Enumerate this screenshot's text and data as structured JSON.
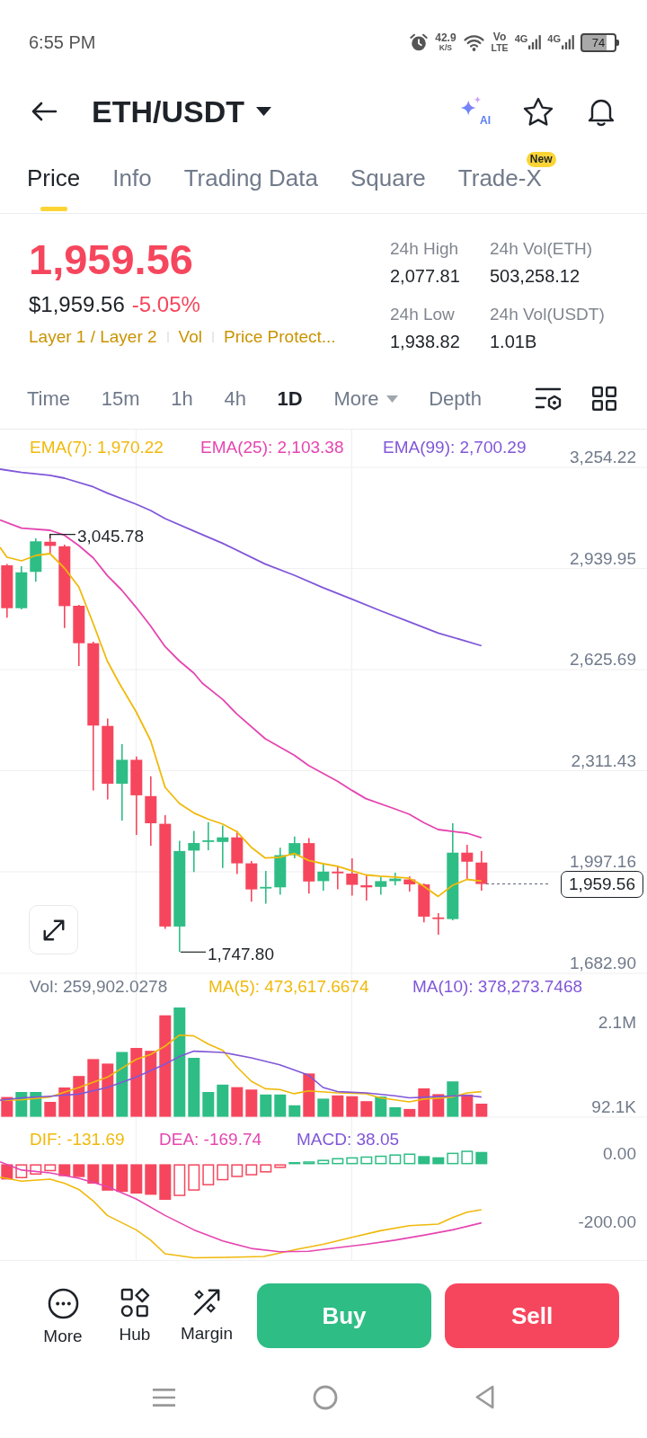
{
  "status_bar": {
    "time": "6:55 PM",
    "speed": "42.9",
    "speed_unit": "K/S",
    "volte": "Vo",
    "volte_sub": "LTE",
    "networks": [
      "4G",
      "4G"
    ],
    "battery": "74"
  },
  "header": {
    "pair": "ETH/USDT",
    "ai_label": "AI"
  },
  "tabs": [
    {
      "label": "Price",
      "selected": true
    },
    {
      "label": "Info",
      "selected": false
    },
    {
      "label": "Trading Data",
      "selected": false
    },
    {
      "label": "Square",
      "selected": false
    },
    {
      "label": "Trade-X",
      "selected": false,
      "badge": "New"
    }
  ],
  "ticker": {
    "falling": true,
    "last_price": "1,959.56",
    "usd_price": "$1,959.56",
    "change": "-5.05%",
    "tags": [
      "Layer 1 / Layer 2",
      "Vol",
      "Price Protect..."
    ],
    "stats": [
      {
        "label": "24h High",
        "value": "2,077.81"
      },
      {
        "label": "24h Vol(ETH)",
        "value": "503,258.12"
      },
      {
        "label": "24h Low",
        "value": "1,938.82"
      },
      {
        "label": "24h Vol(USDT)",
        "value": "1.01B"
      }
    ]
  },
  "intervals": [
    {
      "label": "Time",
      "kind": "option",
      "selected": false
    },
    {
      "label": "15m",
      "kind": "option",
      "selected": false
    },
    {
      "label": "1h",
      "kind": "option",
      "selected": false
    },
    {
      "label": "4h",
      "kind": "option",
      "selected": false
    },
    {
      "label": "1D",
      "kind": "option",
      "selected": true
    },
    {
      "label": "More",
      "kind": "dropdown",
      "selected": false
    },
    {
      "label": "Depth",
      "kind": "option",
      "selected": false
    }
  ],
  "price_chart": {
    "legend": [
      {
        "label": "EMA(7): 1,970.22",
        "color": "#f0b90b"
      },
      {
        "label": "EMA(25): 2,103.38",
        "color": "#e545b0"
      },
      {
        "label": "EMA(99): 2,700.29",
        "color": "#8057d8"
      }
    ],
    "y_axis": [
      "3,254.22",
      "2,939.95",
      "2,625.69",
      "2,311.43",
      "1,997.16",
      "1,682.90"
    ],
    "high_label": "3,045.78",
    "low_label": "1,747.80",
    "last_price_label": "1,959.56"
  },
  "volume_chart": {
    "legend": [
      {
        "label": "Vol: 259,902.0278",
        "color": "#707a8a"
      },
      {
        "label": "MA(5): 473,617.6674",
        "color": "#f0b90b"
      },
      {
        "label": "MA(10): 378,273.7468",
        "color": "#8057d8"
      }
    ],
    "y_axis": [
      "2.1M",
      "92.1K"
    ]
  },
  "macd_chart": {
    "legend": [
      {
        "label": "DIF: -131.69",
        "color": "#f0b90b"
      },
      {
        "label": "DEA: -169.74",
        "color": "#e545b0"
      },
      {
        "label": "MACD: 38.05",
        "color": "#8057d8"
      }
    ],
    "y_axis": [
      "0.00",
      "-200.00"
    ]
  },
  "actions": [
    {
      "label": "More"
    },
    {
      "label": "Hub"
    },
    {
      "label": "Margin"
    }
  ],
  "trade_buttons": [
    {
      "label": "Buy",
      "kind": "buy"
    },
    {
      "label": "Sell",
      "kind": "sell"
    }
  ]
}
